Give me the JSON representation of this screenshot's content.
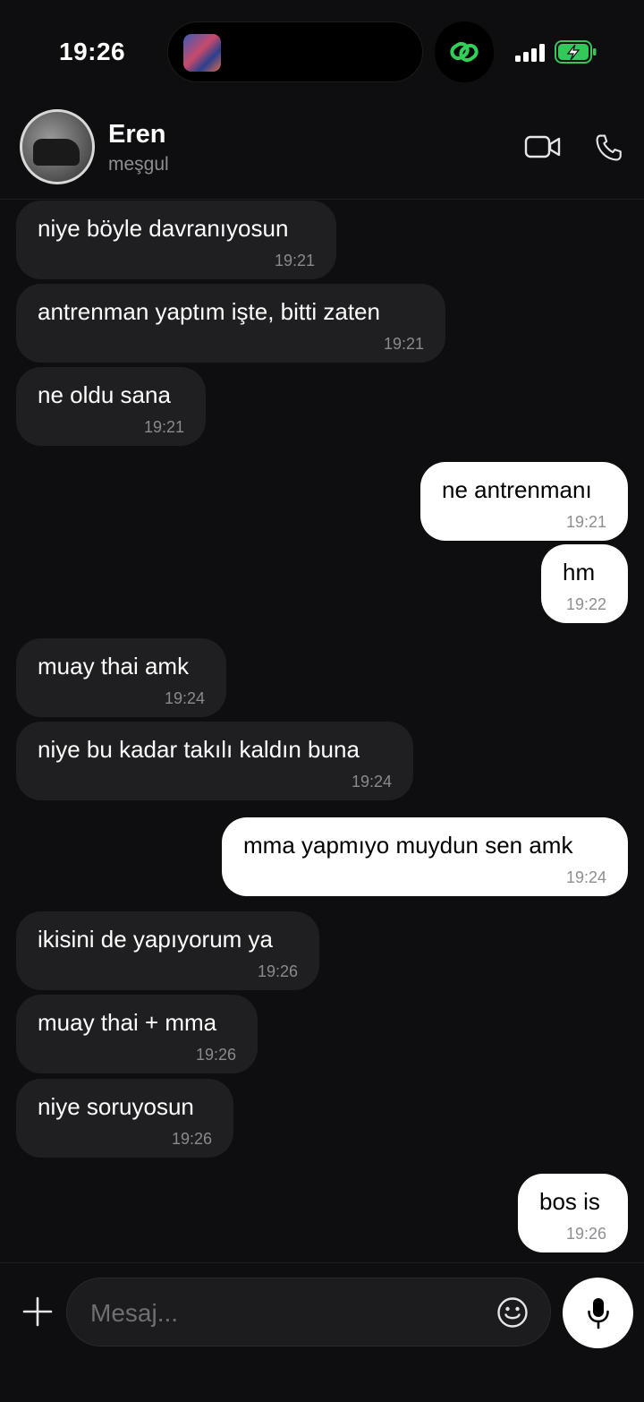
{
  "status_bar": {
    "time": "19:26",
    "battery_state": "charging",
    "battery_color": "#34c759",
    "activity_icon": "link-icon",
    "activity_color": "#30d158"
  },
  "header": {
    "contact_name": "Eren",
    "contact_status": "meşgul",
    "video_icon": "video-camera-icon",
    "call_icon": "phone-icon"
  },
  "messages": [
    {
      "direction": "in",
      "text": "niye böyle davranıyosun",
      "time": "19:21"
    },
    {
      "direction": "in",
      "text": "antrenman yaptım işte, bitti zaten",
      "time": "19:21"
    },
    {
      "direction": "in",
      "text": "ne oldu sana",
      "time": "19:21"
    },
    {
      "direction": "out",
      "text": "ne antrenmanı",
      "time": "19:21"
    },
    {
      "direction": "out",
      "text": "hm",
      "time": "19:22"
    },
    {
      "direction": "in",
      "text": "muay thai amk",
      "time": "19:24"
    },
    {
      "direction": "in",
      "text": "niye bu kadar takılı kaldın buna",
      "time": "19:24"
    },
    {
      "direction": "out",
      "text": "mma yapmıyo muydun sen amk",
      "time": "19:24"
    },
    {
      "direction": "in",
      "text": "ikisini de yapıyorum ya",
      "time": "19:26"
    },
    {
      "direction": "in",
      "text": "muay thai + mma",
      "time": "19:26"
    },
    {
      "direction": "in",
      "text": "niye soruyosun",
      "time": "19:26"
    },
    {
      "direction": "out",
      "text": "bos is",
      "time": "19:26"
    }
  ],
  "composer": {
    "placeholder": "Mesaj...",
    "attach_icon": "plus-icon",
    "emoji_icon": "smiley-icon",
    "mic_icon": "microphone-icon"
  },
  "colors": {
    "background": "#0e0e10",
    "incoming_bubble": "#1f1f22",
    "outgoing_bubble": "#ffffff",
    "timestamp": "#8a8a8e"
  }
}
